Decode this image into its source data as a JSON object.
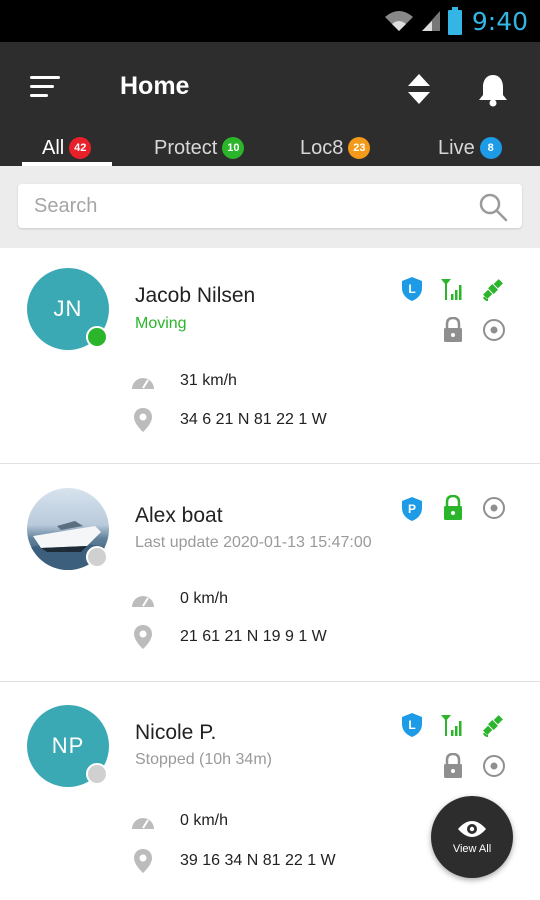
{
  "status_bar": {
    "time": "9:40"
  },
  "app_bar": {
    "title": "Home"
  },
  "tabs": [
    {
      "label": "All",
      "count": "42",
      "color": "#e8202a",
      "active": true
    },
    {
      "label": "Protect",
      "count": "10",
      "color": "#2ab52a",
      "active": false
    },
    {
      "label": "Loc8",
      "count": "23",
      "color": "#f39a1b",
      "active": false
    },
    {
      "label": "Live",
      "count": "8",
      "color": "#1e9be6",
      "active": false
    }
  ],
  "search": {
    "placeholder": "Search"
  },
  "devices": [
    {
      "initials": "JN",
      "name": "Jacob Nilsen",
      "status": "Moving",
      "status_color": "#2ab52a",
      "dot_color": "#2ab52a",
      "speed": "31 km/h",
      "coords": "34 6 21 N 81 22 1 W",
      "badge_letter": "L",
      "icons": [
        "shield-l-icon",
        "signal-icon",
        "satellite-icon",
        "lock-icon",
        "target-icon"
      ]
    },
    {
      "initials": "",
      "name": "Alex boat",
      "status": "Last update 2020-01-13 15:47:00",
      "status_color": "#9a9a9a",
      "dot_color": "#d0d0d0",
      "speed": "0 km/h",
      "coords": "21 61 21 N 19 9 1 W",
      "badge_letter": "P",
      "icons": [
        "shield-p-icon",
        "lock-open-icon",
        "target-icon"
      ]
    },
    {
      "initials": "NP",
      "name": "Nicole P.",
      "status": "Stopped (10h 34m)",
      "status_color": "#9a9a9a",
      "dot_color": "#d0d0d0",
      "speed": "0 km/h",
      "coords": "39 16 34 N 81 22 1 W",
      "badge_letter": "L",
      "icons": [
        "shield-l-icon",
        "signal-icon",
        "satellite-icon",
        "lock-icon",
        "target-icon"
      ]
    }
  ],
  "fab": {
    "label": "View All"
  },
  "colors": {
    "teal": "#3aa9b4",
    "appbar": "#2d2d2d",
    "green": "#2ab52a",
    "blue": "#1e9be6",
    "gray_icon": "#8f8f8f"
  }
}
